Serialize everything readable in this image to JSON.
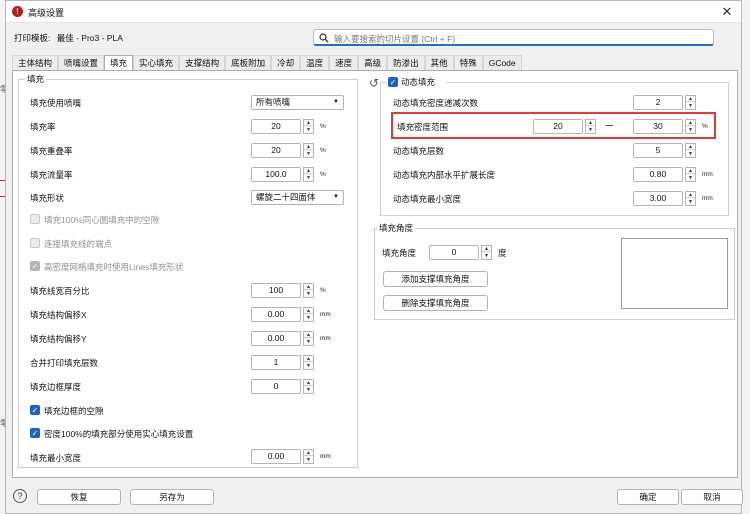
{
  "window": {
    "title": "高级设置",
    "close_glyph": "✕"
  },
  "printer": {
    "label": "打印模板:",
    "value": "最佳 - Pro3 - PLA"
  },
  "search": {
    "placeholder": "输入要搜索的切片设置 (Ctrl + F)"
  },
  "tabs": [
    {
      "label": "主体结构"
    },
    {
      "label": "喷嘴设置"
    },
    {
      "label": "填充",
      "active": true
    },
    {
      "label": "实心填充"
    },
    {
      "label": "支撑结构"
    },
    {
      "label": "底板附加"
    },
    {
      "label": "冷却"
    },
    {
      "label": "温度"
    },
    {
      "label": "速度"
    },
    {
      "label": "高级"
    },
    {
      "label": "防渗出"
    },
    {
      "label": "其他"
    },
    {
      "label": "特殊"
    },
    {
      "label": "GCode"
    }
  ],
  "infill": {
    "group_title": "填充",
    "extruder": {
      "label": "填充使用喷嘴",
      "value": "所有喷嘴"
    },
    "rate": {
      "label": "填充率",
      "value": "20",
      "unit": "%"
    },
    "overlap": {
      "label": "填充重叠率",
      "value": "20",
      "unit": "%"
    },
    "flow": {
      "label": "填充流量率",
      "value": "100.0",
      "unit": "%"
    },
    "pattern": {
      "label": "填充形状",
      "value": "螺旋二十四面体"
    },
    "checks": [
      {
        "label": "填充100%同心圆填充中的空隙",
        "state": "disabled"
      },
      {
        "label": "连接填充线的端点",
        "state": "disabled"
      },
      {
        "label": "高密度网格填充时使用Lines填充形状",
        "state": "disabled-checked"
      }
    ],
    "line_width": {
      "label": "填充线宽百分比",
      "value": "100",
      "unit": "%"
    },
    "offset_x": {
      "label": "填充结构偏移X",
      "value": "0.00",
      "unit": "mm"
    },
    "offset_y": {
      "label": "填充结构偏移Y",
      "value": "0.00",
      "unit": "mm"
    },
    "merge_layers": {
      "label": "合并打印填充层数",
      "value": "1"
    },
    "border_thickness": {
      "label": "填充边框厚度",
      "value": "0"
    },
    "fill_gaps": {
      "label": "填充边框的空隙",
      "checked": true
    },
    "solid_100": {
      "label": "密度100%的填充部分使用实心填充设置",
      "checked": true
    },
    "min_length": {
      "label": "填充最小宽度",
      "value": "0.00",
      "unit": "mm"
    }
  },
  "dynamic": {
    "reset_glyph": "↺",
    "group_title": "动态填充",
    "enabled": true,
    "decrease_steps": {
      "label": "动态填充密度递减次数",
      "value": "2"
    },
    "density_range": {
      "label": "填充密度范围",
      "min": "20",
      "sep": "一",
      "max": "30",
      "unit": "%"
    },
    "layers": {
      "label": "动态填充层数",
      "value": "5"
    },
    "expand": {
      "label": "动态填充内部水平扩展长度",
      "value": "0.80",
      "unit": "mm"
    },
    "min_width": {
      "label": "动态填充最小宽度",
      "value": "3.00",
      "unit": "mm"
    }
  },
  "angle": {
    "group_title": "填充角度",
    "label": "填充角度",
    "value": "0",
    "unit": "度",
    "add_button": "添加支撑填充角度",
    "remove_button": "删除支撑填充角度"
  },
  "footer": {
    "help": "?",
    "restore": "恢复",
    "save_as": "另存为",
    "ok": "确定",
    "cancel": "取消"
  },
  "colors": {
    "accent": "#1d63c7",
    "highlight": "#e53935",
    "brand": "#b71c1c"
  }
}
